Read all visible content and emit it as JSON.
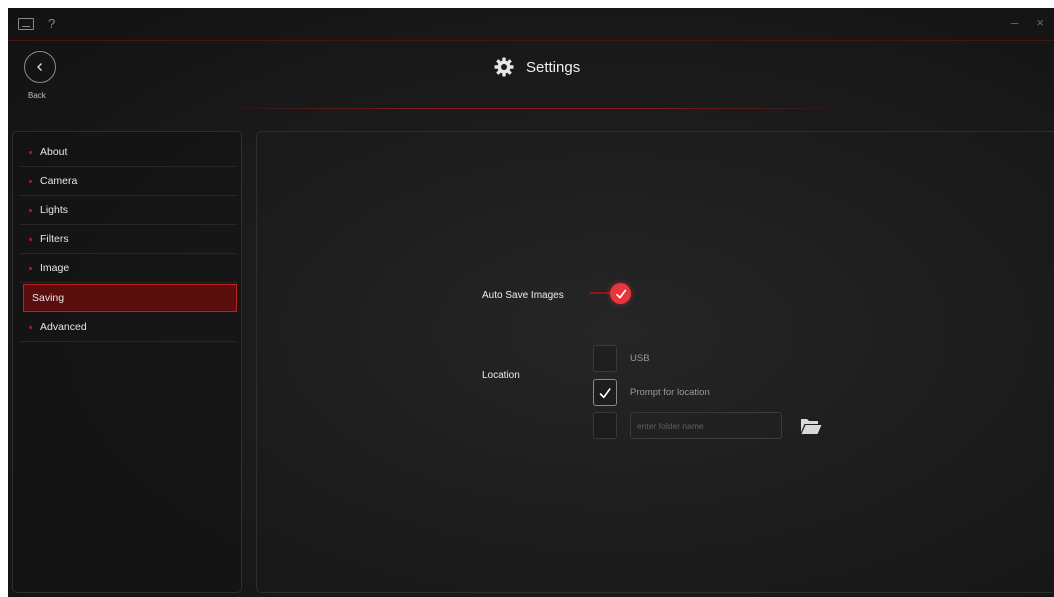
{
  "titlebar": {
    "help_label": "?",
    "minimize_label": "–",
    "close_label": "×"
  },
  "header": {
    "back_label": "Back",
    "title": "Settings"
  },
  "sidebar": {
    "items": [
      {
        "label": "About"
      },
      {
        "label": "Camera"
      },
      {
        "label": "Lights"
      },
      {
        "label": "Filters"
      },
      {
        "label": "Image"
      },
      {
        "label": "Saving",
        "active": true
      },
      {
        "label": "Advanced"
      }
    ]
  },
  "saving": {
    "auto_save_label": "Auto Save Images",
    "auto_save_on": true,
    "location_label": "Location",
    "options": [
      {
        "label": "USB",
        "checked": false
      },
      {
        "label": "Prompt for location",
        "checked": true
      }
    ],
    "folder_placeholder": "enter folder name",
    "folder_value": "",
    "folder_checked": false
  },
  "colors": {
    "accent": "#e8343a",
    "active_bg": "#5a0e0e",
    "active_border": "#c02020",
    "divider": "#8c1a1a"
  },
  "icons": {
    "back": "back-arrow-icon",
    "settings": "gear-icon",
    "keyboard": "keyboard-icon",
    "help": "help-icon",
    "folder": "folder-open-icon",
    "check": "checkmark-icon"
  }
}
